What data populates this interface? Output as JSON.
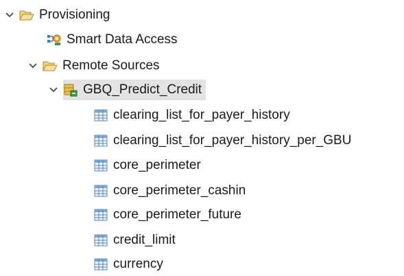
{
  "tree": {
    "provisioning": {
      "label": "Provisioning",
      "icon": "folder-open-icon",
      "expanded": true
    },
    "smart_data_access": {
      "label": "Smart Data Access",
      "icon": "smart-data-access-icon"
    },
    "remote_sources": {
      "label": "Remote Sources",
      "icon": "folder-open-icon",
      "expanded": true
    },
    "gbq_predict_credit": {
      "label": "GBQ_Predict_Credit",
      "icon": "remote-source-database-icon",
      "expanded": true,
      "selected": true
    },
    "tables": [
      {
        "label": "clearing_list_for_payer_history",
        "icon": "table-icon"
      },
      {
        "label": "clearing_list_for_payer_history_per_GBU",
        "icon": "table-icon"
      },
      {
        "label": "core_perimeter",
        "icon": "table-icon"
      },
      {
        "label": "core_perimeter_cashin",
        "icon": "table-icon"
      },
      {
        "label": "core_perimeter_future",
        "icon": "table-icon"
      },
      {
        "label": "credit_limit",
        "icon": "table-icon"
      },
      {
        "label": "currency",
        "icon": "table-icon"
      }
    ]
  },
  "colors": {
    "folder": "#e8b84a",
    "chevron": "#4a4a4a",
    "table_header": "#7fa7d6",
    "table_grid": "#5b87c0",
    "selection": "#e3e3e3"
  }
}
